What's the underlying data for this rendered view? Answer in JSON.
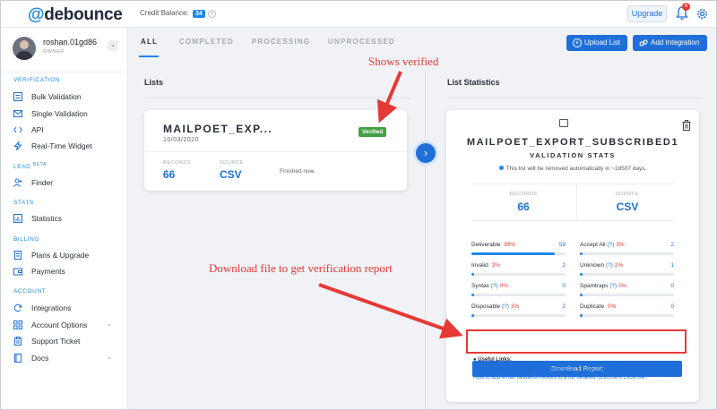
{
  "topbar": {
    "logo_at": "@",
    "logo_text": "debounce",
    "credit_label": "Credit Balance:",
    "credit_value": "34",
    "credit_plus": "+",
    "upgrade_label": "Upgrade",
    "notification_count": "6"
  },
  "user": {
    "name": "roshan.01gd86",
    "role": "OWNER"
  },
  "sidebar": {
    "sections": [
      {
        "title": "VERIFICATION",
        "items": [
          {
            "label": "Bulk Validation",
            "icon": "list-icon"
          },
          {
            "label": "Single Validation",
            "icon": "envelope-icon"
          },
          {
            "label": "API",
            "icon": "code-icon"
          },
          {
            "label": "Real-Time Widget",
            "icon": "bolt-icon"
          }
        ]
      },
      {
        "title": "LEAD",
        "title_sup": "BETA",
        "items": [
          {
            "label": "Finder",
            "icon": "user-plus-icon"
          }
        ]
      },
      {
        "title": "STATS",
        "items": [
          {
            "label": "Statistics",
            "icon": "chart-icon"
          }
        ]
      },
      {
        "title": "BILLING",
        "items": [
          {
            "label": "Plans & Upgrade",
            "icon": "document-icon"
          },
          {
            "label": "Payments",
            "icon": "wallet-icon"
          }
        ]
      },
      {
        "title": "ACCOUNT",
        "items": [
          {
            "label": "Integrations",
            "icon": "refresh-icon"
          },
          {
            "label": "Account Options",
            "icon": "grid-icon"
          },
          {
            "label": "Support Ticket",
            "icon": "clipboard-icon"
          },
          {
            "label": "Docs",
            "icon": "book-icon"
          }
        ]
      }
    ]
  },
  "tabs": [
    "ALL",
    "COMPLETED",
    "PROCESSING",
    "UNPROCESSED"
  ],
  "buttons": {
    "upload_list": "Upload List",
    "add_integration": "Add Integration"
  },
  "lists_pane": {
    "title": "Lists",
    "card": {
      "name": "MAILPOET_EXP...",
      "date": "10/03/2020",
      "status": "Verified",
      "records_label": "RECORDS",
      "records_value": "66",
      "source_label": "SOURCE",
      "source_value": "CSV",
      "finished": "Finished now."
    }
  },
  "stats_pane": {
    "title": "List Statistics",
    "list_name": "MAILPOET_EXPORT_SUBSCRIBED1",
    "subtitle": "VALIDATION STATS",
    "note": "This list will be removed automatically in ~18507 days.",
    "records_label": "RECORDS",
    "records_value": "66",
    "source_label": "SOURCE",
    "source_value": "CSV",
    "stats": [
      {
        "name": "Deliverable",
        "help": "",
        "pct": "89%",
        "count": "59",
        "fraction": 0.89
      },
      {
        "name": "Accept All",
        "help": "(?)",
        "pct": "3%",
        "count": "2",
        "fraction": 0.03
      },
      {
        "name": "Invalid",
        "help": "",
        "pct": "3%",
        "count": "2",
        "fraction": 0.03
      },
      {
        "name": "Unknown",
        "help": "(?)",
        "pct": "2%",
        "count": "1",
        "fraction": 0.02
      },
      {
        "name": "Syntax",
        "help": "(?)",
        "pct": "0%",
        "count": "0",
        "fraction": 0
      },
      {
        "name": "Spamtraps",
        "help": "(?)",
        "pct": "0%",
        "count": "0",
        "fraction": 0
      },
      {
        "name": "Disposable",
        "help": "(?)",
        "pct": "3%",
        "count": "2",
        "fraction": 0.03
      },
      {
        "name": "Duplicate",
        "help": "",
        "pct": "0%",
        "count": "0",
        "fraction": 0
      }
    ],
    "download_label": "Download Report",
    "useful_title": "Useful Links:",
    "links_line1": [
      "Understanding Results",
      "What's Accept-all?",
      "Keep Unknowns?"
    ],
    "links_line2": "How to add email validation results to a full detailed customers Excel file?"
  },
  "annotations": {
    "shows_verified": "Shows verified",
    "download_note": "Download file to get verification report",
    "color": "#e53935"
  },
  "colors": {
    "accent": "#1e6fd9",
    "verified": "#43a047",
    "danger": "#e53935"
  }
}
